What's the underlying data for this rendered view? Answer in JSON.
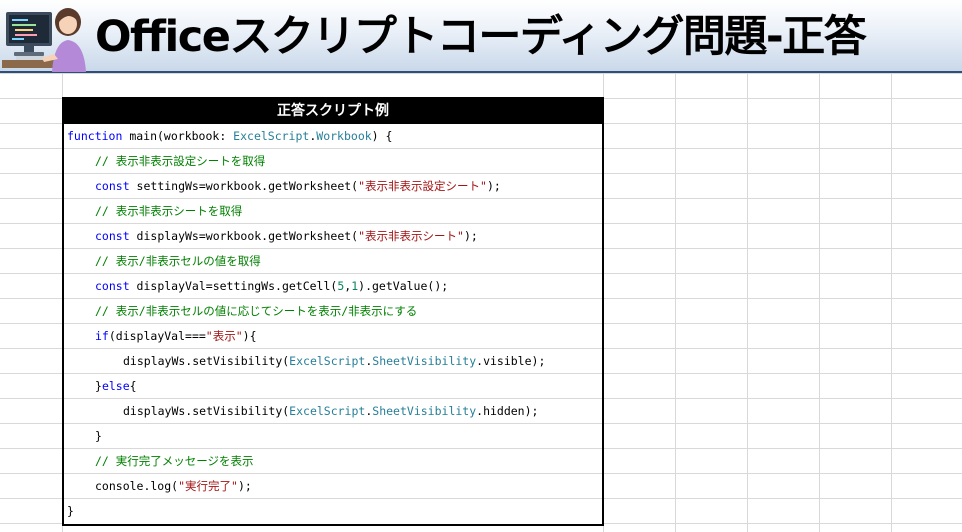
{
  "banner": {
    "title": "Officeスクリプトコーディング問題-正答"
  },
  "code_box": {
    "header": "正答スクリプト例",
    "lines": [
      {
        "indent": 0,
        "tokens": [
          {
            "t": "function",
            "c": "kw"
          },
          {
            "t": " main(workbook: "
          },
          {
            "t": "ExcelScript",
            "c": "ty"
          },
          {
            "t": "."
          },
          {
            "t": "Workbook",
            "c": "ty"
          },
          {
            "t": ") {"
          }
        ]
      },
      {
        "indent": 1,
        "tokens": [
          {
            "t": "// 表示非表示設定シートを取得",
            "c": "cm"
          }
        ]
      },
      {
        "indent": 1,
        "tokens": [
          {
            "t": "const",
            "c": "kw"
          },
          {
            "t": " settingWs=workbook.getWorksheet("
          },
          {
            "t": "\"表示非表示設定シート\"",
            "c": "st"
          },
          {
            "t": ");"
          }
        ]
      },
      {
        "indent": 1,
        "tokens": [
          {
            "t": "// 表示非表示シートを取得",
            "c": "cm"
          }
        ]
      },
      {
        "indent": 1,
        "tokens": [
          {
            "t": "const",
            "c": "kw"
          },
          {
            "t": " displayWs=workbook.getWorksheet("
          },
          {
            "t": "\"表示非表示シート\"",
            "c": "st"
          },
          {
            "t": ");"
          }
        ]
      },
      {
        "indent": 1,
        "tokens": [
          {
            "t": "// 表示/非表示セルの値を取得",
            "c": "cm"
          }
        ]
      },
      {
        "indent": 1,
        "tokens": [
          {
            "t": "const",
            "c": "kw"
          },
          {
            "t": " displayVal=settingWs.getCell("
          },
          {
            "t": "5",
            "c": "nm"
          },
          {
            "t": ","
          },
          {
            "t": "1",
            "c": "nm"
          },
          {
            "t": ").getValue();"
          }
        ]
      },
      {
        "indent": 1,
        "tokens": [
          {
            "t": "// 表示/非表示セルの値に応じてシートを表示/非表示にする",
            "c": "cm"
          }
        ]
      },
      {
        "indent": 1,
        "tokens": [
          {
            "t": "if",
            "c": "kw"
          },
          {
            "t": "(displayVal==="
          },
          {
            "t": "\"表示\"",
            "c": "st"
          },
          {
            "t": "){"
          }
        ]
      },
      {
        "indent": 2,
        "tokens": [
          {
            "t": "displayWs.setVisibility("
          },
          {
            "t": "ExcelScript",
            "c": "ty"
          },
          {
            "t": "."
          },
          {
            "t": "SheetVisibility",
            "c": "ty"
          },
          {
            "t": ".visible);"
          }
        ]
      },
      {
        "indent": 1,
        "tokens": [
          {
            "t": "}"
          },
          {
            "t": "else",
            "c": "kw"
          },
          {
            "t": "{"
          }
        ]
      },
      {
        "indent": 2,
        "tokens": [
          {
            "t": "displayWs.setVisibility("
          },
          {
            "t": "ExcelScript",
            "c": "ty"
          },
          {
            "t": "."
          },
          {
            "t": "SheetVisibility",
            "c": "ty"
          },
          {
            "t": ".hidden);"
          }
        ]
      },
      {
        "indent": 1,
        "tokens": [
          {
            "t": "}"
          }
        ]
      },
      {
        "indent": 1,
        "tokens": [
          {
            "t": "// 実行完了メッセージを表示",
            "c": "cm"
          }
        ]
      },
      {
        "indent": 1,
        "tokens": [
          {
            "t": "console.log("
          },
          {
            "t": "\"実行完了\"",
            "c": "st"
          },
          {
            "t": ");"
          }
        ]
      },
      {
        "indent": 0,
        "tokens": [
          {
            "t": "}"
          }
        ]
      }
    ]
  },
  "colors": {
    "keyword": "#0000ff",
    "type": "#267f99",
    "string": "#a31515",
    "comment": "#008000",
    "number": "#098658",
    "header_bg": "#000000",
    "grid_line": "#d9d9d9"
  },
  "icons": {
    "banner_illustration": "person-at-computer-icon"
  }
}
